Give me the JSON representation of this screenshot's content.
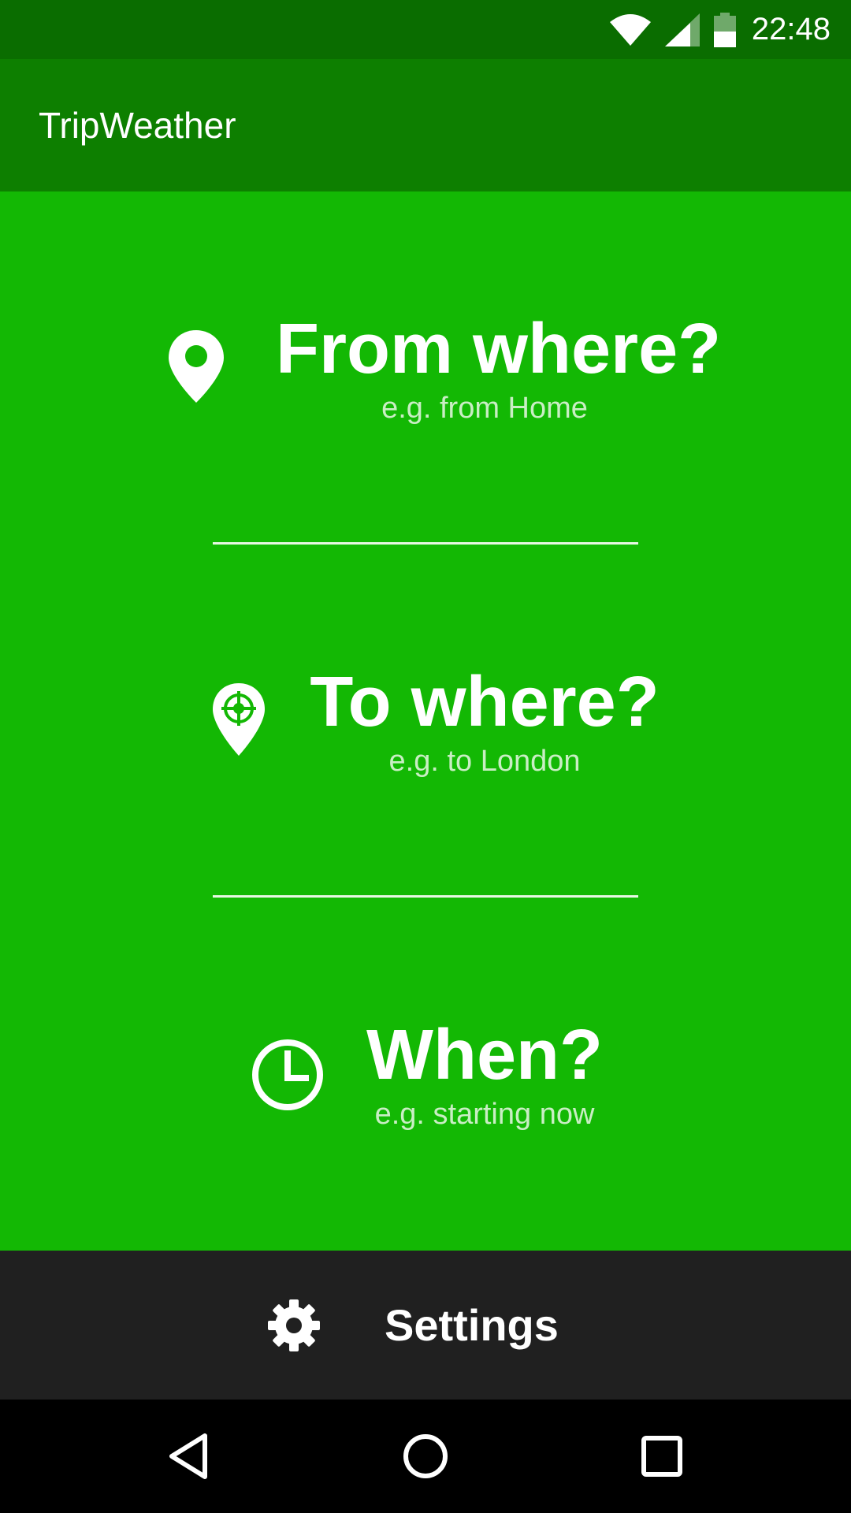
{
  "status_bar": {
    "time": "22:48",
    "icons": [
      "wifi-icon",
      "cellular-signal-icon",
      "battery-icon"
    ]
  },
  "app_bar": {
    "title": "TripWeather"
  },
  "main": {
    "from": {
      "title": "From where?",
      "hint": "e.g. from Home",
      "icon": "location-pin-icon"
    },
    "to": {
      "title": "To where?",
      "hint": "e.g. to London",
      "icon": "destination-pin-icon"
    },
    "when": {
      "title": "When?",
      "hint": "e.g. starting now",
      "icon": "clock-icon"
    }
  },
  "settings": {
    "label": "Settings",
    "icon": "gear-icon"
  },
  "nav_bar": {
    "icons": [
      "back-icon",
      "home-icon",
      "recents-icon"
    ]
  },
  "colors": {
    "status_bar": "#0a6d00",
    "app_bar": "#0d7f00",
    "main_bg": "#13b804",
    "settings_bg": "#202020",
    "nav_bg": "#000000"
  }
}
